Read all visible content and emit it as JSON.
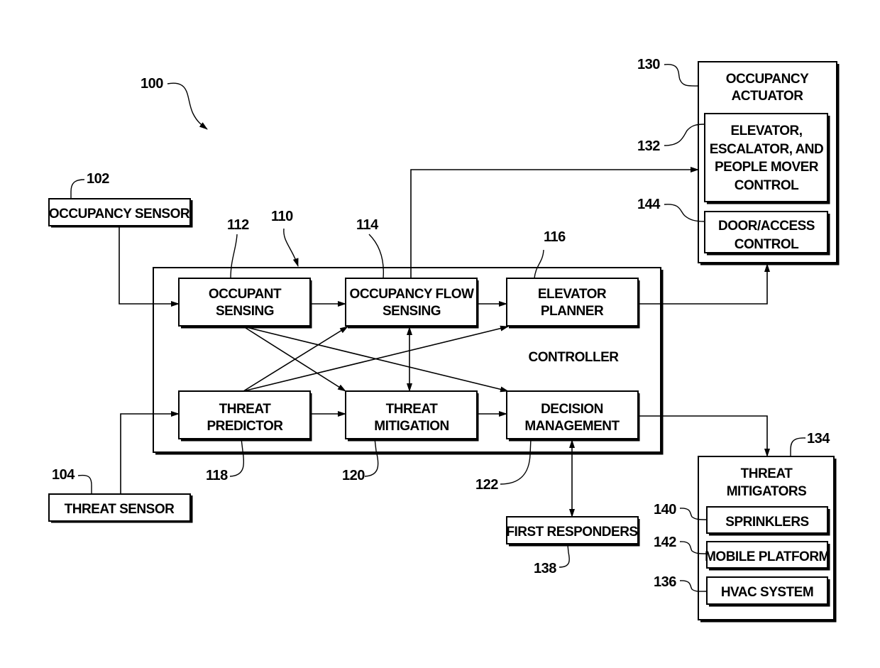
{
  "figure": {
    "ref": "100",
    "controller": {
      "ref": "110",
      "label": "CONTROLLER"
    },
    "blocks": {
      "occupancy_sensor": {
        "ref": "102",
        "lines": [
          "OCCUPANCY SENSOR"
        ]
      },
      "threat_sensor": {
        "ref": "104",
        "lines": [
          "THREAT SENSOR"
        ]
      },
      "occupant_sensing": {
        "ref": "112",
        "lines": [
          "OCCUPANT",
          "SENSING"
        ]
      },
      "occupancy_flow_sensing": {
        "ref": "114",
        "lines": [
          "OCCUPANCY FLOW",
          "SENSING"
        ]
      },
      "elevator_planner": {
        "ref": "116",
        "lines": [
          "ELEVATOR",
          "PLANNER"
        ]
      },
      "threat_predictor": {
        "ref": "118",
        "lines": [
          "THREAT",
          "PREDICTOR"
        ]
      },
      "threat_mitigation": {
        "ref": "120",
        "lines": [
          "THREAT",
          "MITIGATION"
        ]
      },
      "decision_management": {
        "ref": "122",
        "lines": [
          "DECISION",
          "MANAGEMENT"
        ]
      },
      "occupancy_actuator": {
        "ref": "130",
        "lines": [
          "OCCUPANCY",
          "ACTUATOR"
        ]
      },
      "elevator_control": {
        "ref": "132",
        "lines": [
          "ELEVATOR,",
          "ESCALATOR, AND",
          "PEOPLE MOVER",
          "CONTROL"
        ]
      },
      "door_access_control": {
        "ref": "144",
        "lines": [
          "DOOR/ACCESS",
          "CONTROL"
        ]
      },
      "threat_mitigators": {
        "ref": "134",
        "lines": [
          "THREAT",
          "MITIGATORS"
        ]
      },
      "sprinklers": {
        "ref": "140",
        "lines": [
          "SPRINKLERS"
        ]
      },
      "mobile_platform": {
        "ref": "142",
        "lines": [
          "MOBILE PLATFORM"
        ]
      },
      "hvac_system": {
        "ref": "136",
        "lines": [
          "HVAC SYSTEM"
        ]
      },
      "first_responders": {
        "ref": "138",
        "lines": [
          "FIRST RESPONDERS"
        ]
      }
    },
    "connections": [
      {
        "from": "occupancy_sensor",
        "to": "occupant_sensing",
        "type": "arrow"
      },
      {
        "from": "threat_sensor",
        "to": "threat_predictor",
        "type": "arrow"
      },
      {
        "from": "occupant_sensing",
        "to": "occupancy_flow_sensing",
        "type": "arrow"
      },
      {
        "from": "occupancy_flow_sensing",
        "to": "elevator_planner",
        "type": "arrow"
      },
      {
        "from": "threat_predictor",
        "to": "threat_mitigation",
        "type": "arrow"
      },
      {
        "from": "threat_mitigation",
        "to": "decision_management",
        "type": "arrow"
      },
      {
        "from": "occupant_sensing",
        "to": "threat_mitigation",
        "type": "arrow"
      },
      {
        "from": "occupant_sensing",
        "to": "decision_management",
        "type": "arrow"
      },
      {
        "from": "threat_predictor",
        "to": "occupancy_flow_sensing",
        "type": "arrow"
      },
      {
        "from": "threat_predictor",
        "to": "elevator_planner",
        "type": "arrow"
      },
      {
        "from": "occupancy_flow_sensing",
        "to": "threat_mitigation",
        "type": "bidirectional"
      },
      {
        "from": "occupancy_flow_sensing",
        "to": "occupancy_actuator",
        "type": "arrow"
      },
      {
        "from": "elevator_planner",
        "to": "occupancy_actuator",
        "type": "arrow"
      },
      {
        "from": "decision_management",
        "to": "threat_mitigators",
        "type": "arrow"
      },
      {
        "from": "decision_management",
        "to": "first_responders",
        "type": "bidirectional"
      }
    ]
  }
}
